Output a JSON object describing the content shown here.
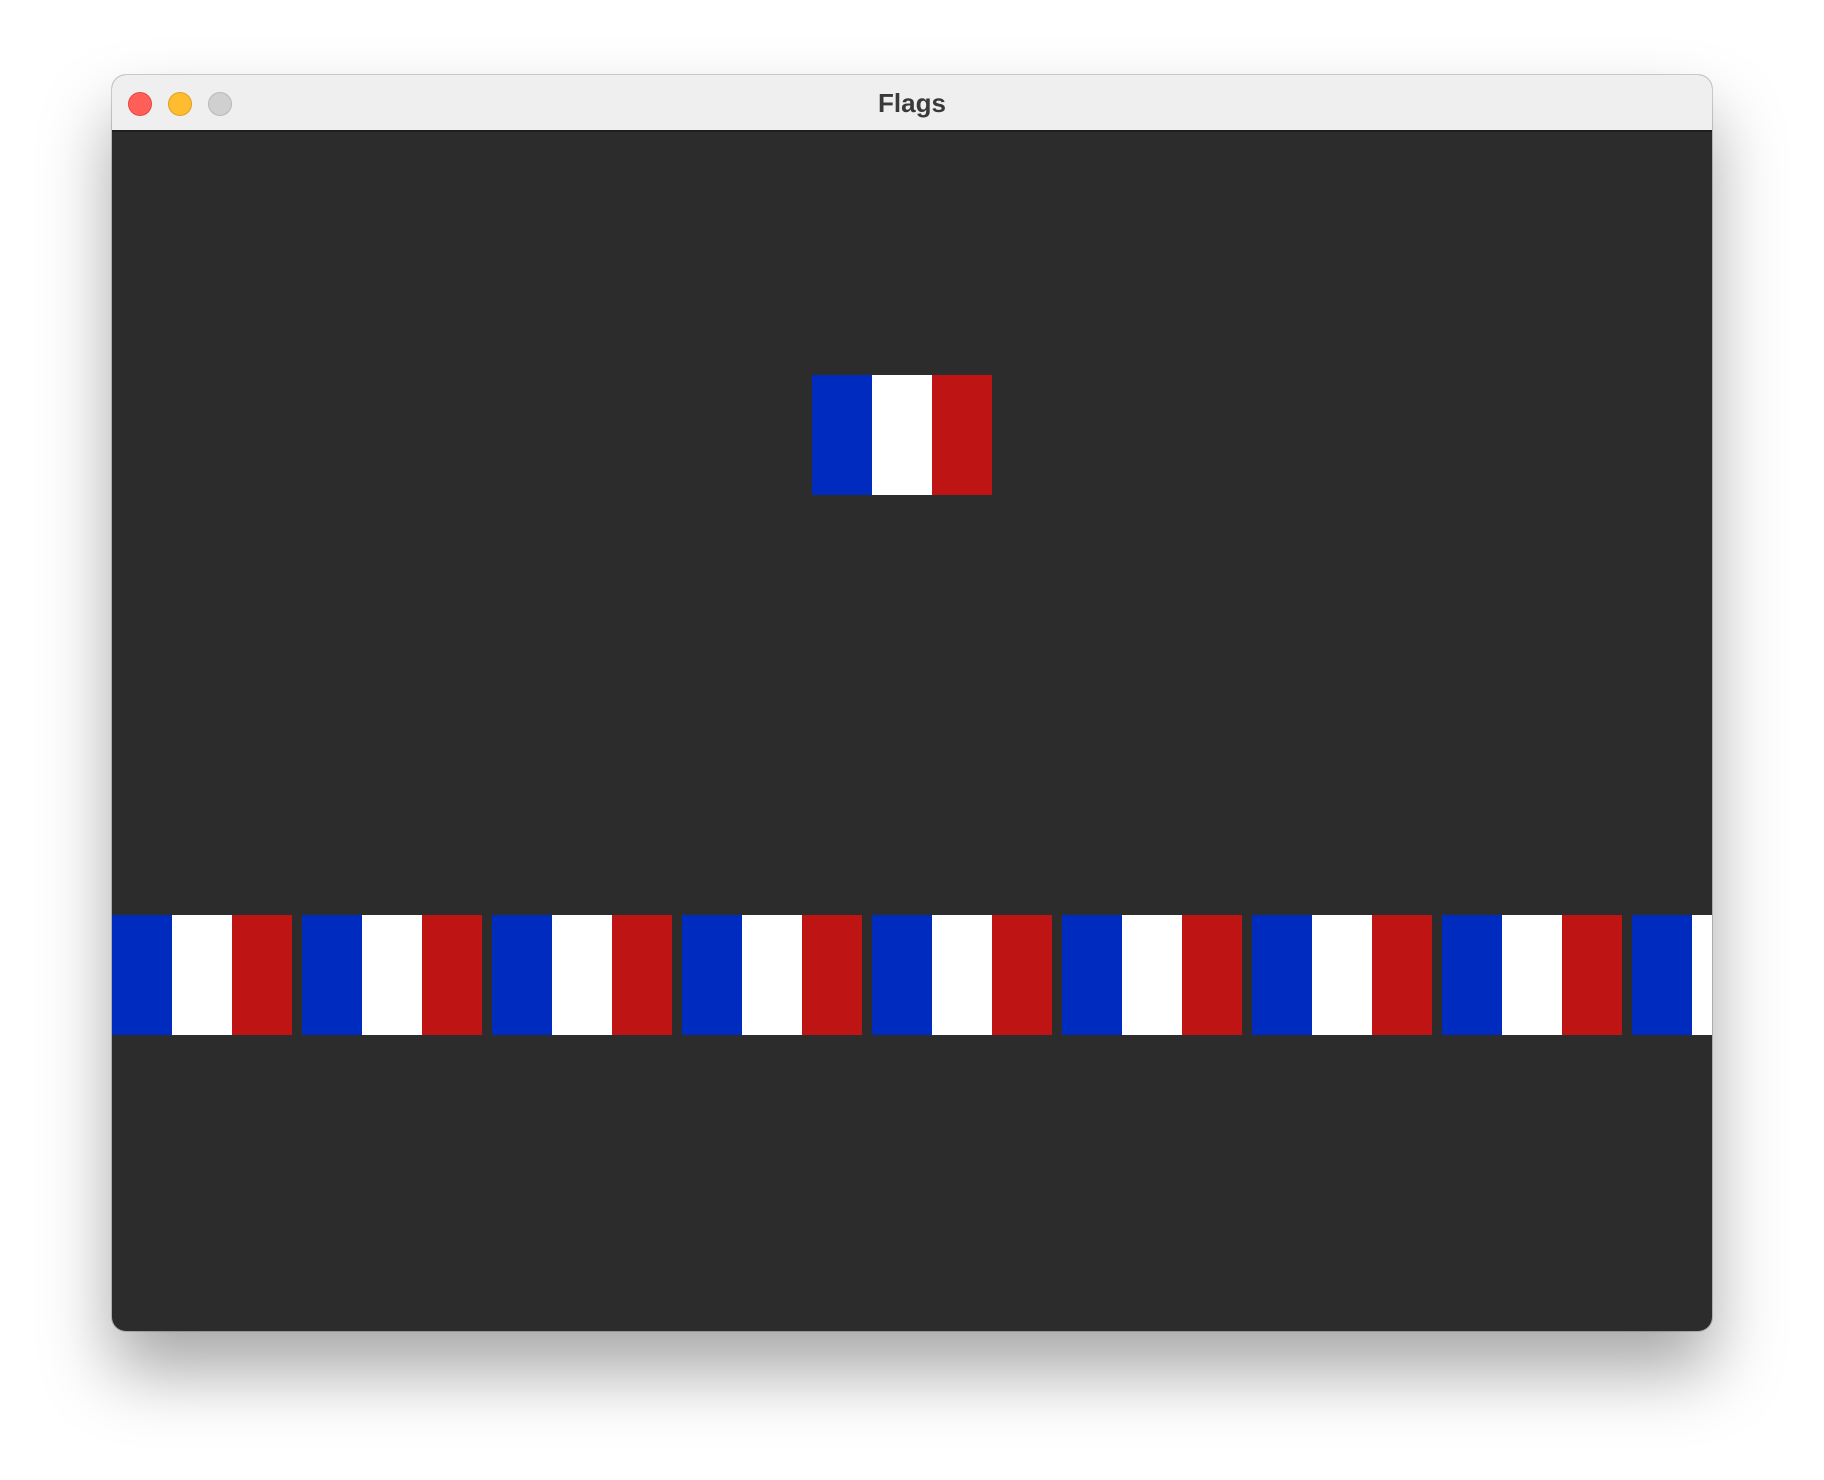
{
  "window": {
    "title": "Flags"
  },
  "colors": {
    "close": "#ff5f57",
    "close_border": "#e14942",
    "minimize": "#febc2e",
    "minimize_border": "#dea123",
    "zoom": "#d0d0d0",
    "zoom_border": "#b8b8b8",
    "content_background": "#2c2c2c",
    "titlebar_background": "#efefef"
  },
  "flag": {
    "name": "France",
    "stripes": [
      "#002bbf",
      "#ffffff",
      "#be1414"
    ]
  },
  "flag_row": {
    "count_visible": 9
  }
}
